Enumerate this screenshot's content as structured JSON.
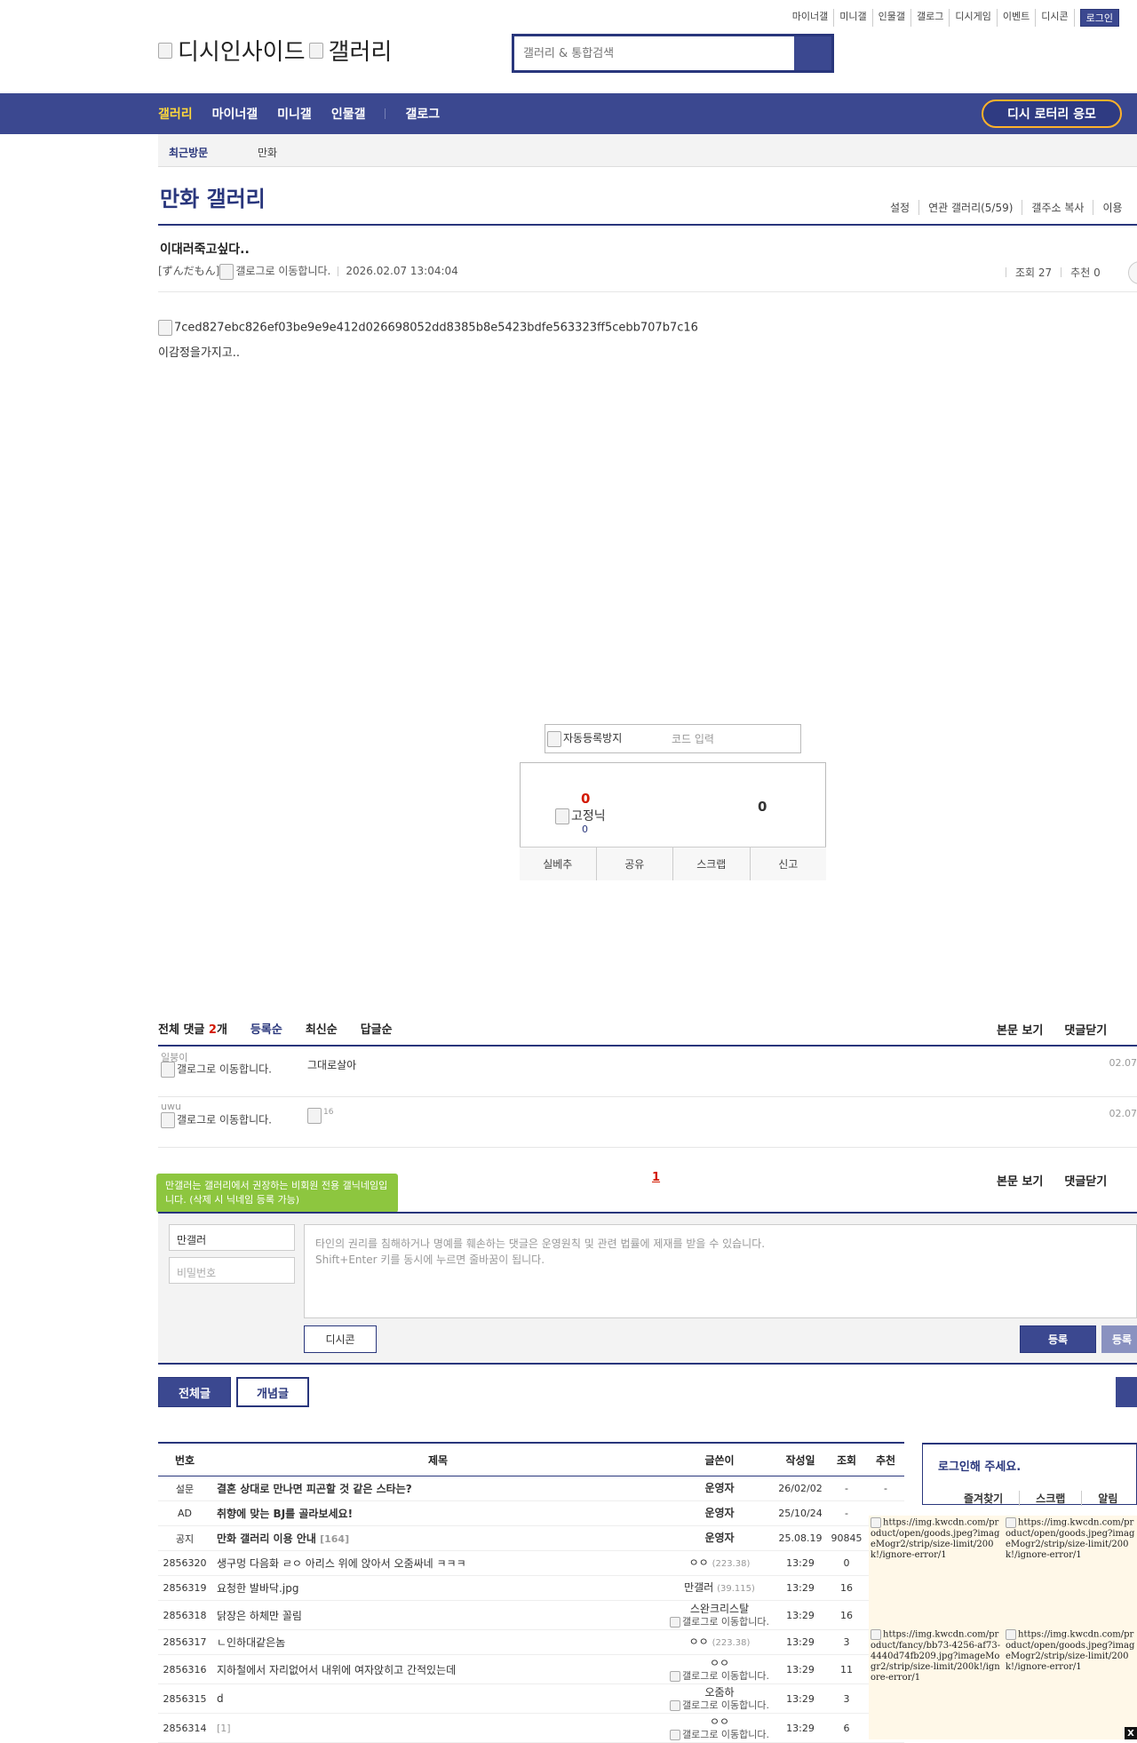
{
  "top_links": [
    "마이너갤",
    "미니갤",
    "인물갤",
    "갤로그",
    "디시게임",
    "이벤트",
    "디시콘"
  ],
  "login_label": "로그인",
  "logo": {
    "site": "디시인사이드",
    "gallery": "갤러리"
  },
  "search": {
    "placeholder": "갤러리 & 통합검색"
  },
  "nav": {
    "items": [
      "갤러리",
      "마이너갤",
      "미니갤",
      "인물갤"
    ],
    "gallog": "갤로그",
    "lotto": "디시 로터리 응모"
  },
  "recent": {
    "label": "최근방문",
    "item": "만화"
  },
  "gallery": {
    "title": "만화 갤러리",
    "links": [
      "설정",
      "연관 갤러리(5/59)",
      "갤주소 복사",
      "이용"
    ]
  },
  "post": {
    "title": "이대러죽고싶다..",
    "nick": "[ずんだもん]",
    "gallog_alt": "갤로그로 이동합니다.",
    "date": "2026.02.07 13:04:04",
    "views": "조회 27",
    "recommend": "추천 0",
    "image_alt": "7ced827ebc826ef03be9e9e412d026698052dd8385b8e5423bdfe563323ff5cebb707b7c16",
    "body": "이감정을가지고.."
  },
  "captcha": {
    "alt": "자동등록방지",
    "placeholder": "코드 입력"
  },
  "rec": {
    "up": "0",
    "fixed_alt": "고정닉",
    "fixed_count": "0",
    "down": "0",
    "actions": [
      "실베추",
      "공유",
      "스크랩",
      "신고"
    ]
  },
  "comments": {
    "header_label": "전체 댓글",
    "count": "2",
    "count_unit": "개",
    "sorts": [
      "등록순",
      "최신순",
      "답글순"
    ],
    "view_body": "본문 보기",
    "close": "댓글닫기",
    "items": [
      {
        "nick": "일붕이",
        "gallog": "갤로그로 이동합니다.",
        "text": "그대로살아",
        "date": "02.07"
      },
      {
        "nick": "uwu",
        "gallog": "갤로그로 이동합니다.",
        "text": "16",
        "date": "02.07"
      }
    ],
    "page": "1"
  },
  "write": {
    "tooltip": "만갤러는 갤러리에서 권장하는 비회원 전용 갤닉네임입니다. (삭제 시 닉네임 등록 가능)",
    "nick_value": "만갤러",
    "pw_placeholder": "비밀번호",
    "textarea_line1": "타인의 권리를 침해하거나 명예를 훼손하는 댓글은 운영원칙 및 관련 법률에 제재를 받을 수 있습니다.",
    "textarea_line2": "Shift+Enter 키를 동시에 누르면 줄바꿈이 됩니다.",
    "dccon": "디시콘",
    "submit": "등록",
    "submit2": "등록"
  },
  "list_tabs": {
    "all": "전체글",
    "concept": "개념글"
  },
  "list": {
    "headers": [
      "번호",
      "제목",
      "글쓴이",
      "작성일",
      "조회",
      "추천"
    ],
    "rows": [
      {
        "num": "설문",
        "subject": "결혼 상대로 만나면 피곤할 것 같은 스타는?",
        "reply": "",
        "writer": "운영자",
        "ip": "",
        "date": "26/02/02",
        "views": "-",
        "rec": "-",
        "style": "red-bold"
      },
      {
        "num": "AD",
        "subject": "취향에 맞는 BJ를 골라보세요!",
        "reply": "",
        "writer": "운영자",
        "ip": "",
        "date": "25/10/24",
        "views": "-",
        "rec": "",
        "style": "bold"
      },
      {
        "num": "공지",
        "subject": "만화 갤러리 이용 안내",
        "reply": "[164]",
        "writer": "운영자",
        "ip": "",
        "date": "25.08.19",
        "views": "90845",
        "rec": "",
        "style": "bold"
      },
      {
        "num": "2856320",
        "subject": "생구멍 다음화 ㄹㅇ 아리스 위에 앉아서 오줌싸네 ㅋㅋㅋ",
        "reply": "",
        "writer": "ㅇㅇ",
        "ip": "(223.38)",
        "date": "13:29",
        "views": "0",
        "rec": "",
        "style": ""
      },
      {
        "num": "2856319",
        "subject": "요청한 발바닥.jpg",
        "reply": "",
        "writer": "만갤러",
        "ip": "(39.115)",
        "date": "13:29",
        "views": "16",
        "rec": "",
        "style": ""
      },
      {
        "num": "2856318",
        "subject": "닭장은 하체만 꼴림",
        "reply": "",
        "writer": "스완크리스탈",
        "ip": "",
        "date": "13:29",
        "views": "16",
        "rec": "",
        "style": "",
        "gallog": "갤로그로 이동합니다."
      },
      {
        "num": "2856317",
        "subject": "ㄴ인하대같은놈",
        "reply": "",
        "writer": "ㅇㅇ",
        "ip": "(223.38)",
        "date": "13:29",
        "views": "3",
        "rec": "",
        "style": ""
      },
      {
        "num": "2856316",
        "subject": "지하철에서 자리없어서 내위에 여자앉히고 간적있는데",
        "reply": "",
        "writer": "ㅇㅇ",
        "ip": "",
        "date": "13:29",
        "views": "11",
        "rec": "",
        "style": "",
        "gallog": "갤로그로 이동합니다."
      },
      {
        "num": "2856315",
        "subject": "d",
        "reply": "",
        "writer": "오줌하",
        "ip": "",
        "date": "13:29",
        "views": "3",
        "rec": "",
        "style": "",
        "gallog": "갤로그로 이동합니다."
      },
      {
        "num": "2856314",
        "subject": "",
        "reply": "[1]",
        "writer": "ㅇㅇ",
        "ip": "",
        "date": "13:29",
        "views": "6",
        "rec": "",
        "style": "",
        "gallog": "갤로그로 이동합니다."
      }
    ]
  },
  "side": {
    "login_title": "로그인해 주세요.",
    "tabs": [
      "즐겨찾기",
      "스크랩",
      "알림"
    ],
    "ads": [
      "https://img.kwcdn.com/product/open/goods.jpeg?imageMogr2/strip/size-limit/200k!/ignore-error/1",
      "https://img.kwcdn.com/product/open/goods.jpeg?imageMogr2/strip/size-limit/200k!/ignore-error/1",
      "https://img.kwcdn.com/product/fancy/bb73-4256-af73-4440d74fb209.jpg?imageMogr2/strip/size-limit/200k!/ignore-error/1",
      "https://img.kwcdn.com/product/open/goods.jpeg?imageMogr2/strip/size-limit/200k!/ignore-error/1"
    ],
    "close": "X"
  }
}
